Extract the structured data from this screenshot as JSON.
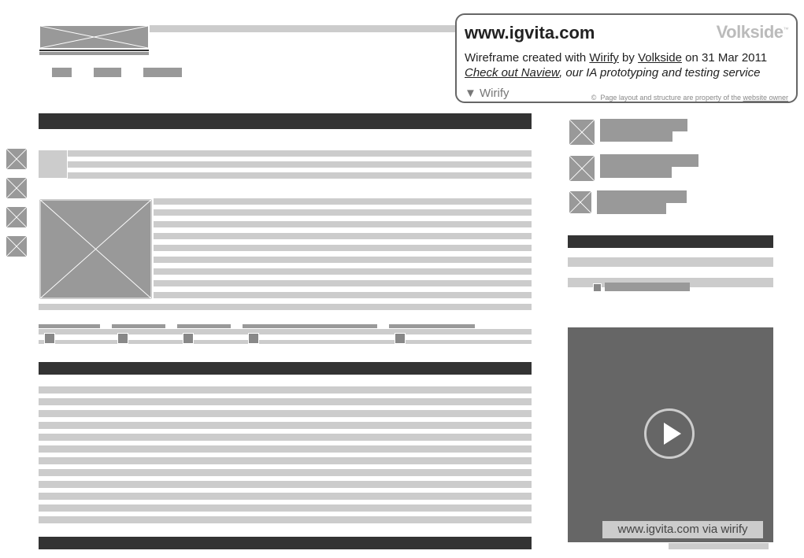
{
  "overlay": {
    "site_title": "www.igvita.com",
    "brand": "Volkside",
    "brand_tm": "™",
    "credit_prefix": "Wireframe created with ",
    "credit_tool_link": "Wirify",
    "credit_by": " by ",
    "credit_author_link": "Volkside",
    "credit_date": " on 31 Mar 2011",
    "promo_link": "Check out Naview",
    "promo_text": ", our IA prototyping and testing service",
    "toggle_label": "▼ Wirify",
    "copyright_symbol": "©",
    "copyright_text": "Page layout and structure are property of the ",
    "copyright_link": "website owner"
  },
  "video": {
    "caption": "www.igvita.com via wirify",
    "play_icon": "play-icon"
  },
  "colors": {
    "light_block": "#cccccc",
    "mid_block": "#999999",
    "dark_bar": "#333333",
    "video_bg": "#666666"
  }
}
